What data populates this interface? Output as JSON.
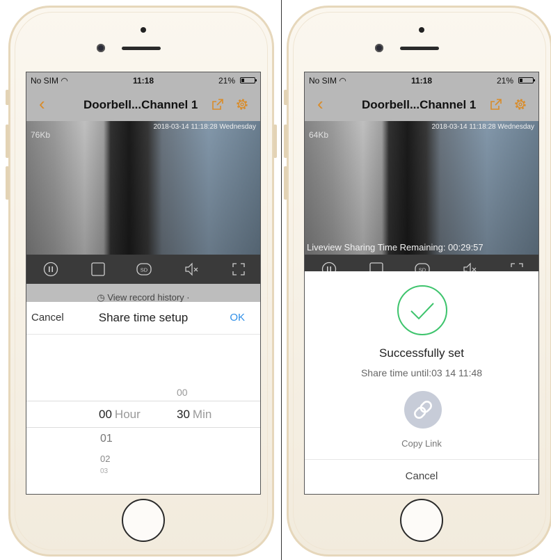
{
  "status_bar": {
    "carrier": "No SIM",
    "time": "11:18",
    "battery": "21%",
    "battery_level": 0.21
  },
  "left_screen": {
    "nav_title": "Doorbell...Channel 1",
    "video": {
      "osd_timestamp": "2018-03-14 11:18:28 Wednesday",
      "bitrate": "76Kb"
    },
    "controls": [
      "pause",
      "record",
      "SD",
      "mute",
      "fullscreen"
    ],
    "history_text": "View record history",
    "share_sheet": {
      "cancel": "Cancel",
      "title": "Share time setup",
      "ok": "OK",
      "hour_above": "",
      "hour_selected": "00",
      "hour_unit": "Hour",
      "hour_below": [
        "01",
        "02",
        "03"
      ],
      "min_above": "00",
      "min_selected": "30",
      "min_unit": "Min"
    }
  },
  "right_screen": {
    "nav_title": "Doorbell...Channel 1",
    "video": {
      "osd_timestamp": "2018-03-14 11:18:28 Wednesday",
      "bitrate": "64Kb",
      "share_banner": "Liveview Sharing Time Remaining: 00:29:57"
    },
    "dialog": {
      "title": "Successfully set",
      "subtitle": "Share time until:03 14 11:48",
      "copy_link": "Copy Link",
      "cancel": "Cancel"
    }
  },
  "colors": {
    "accent_orange": "#d98c2a",
    "ok_blue": "#2f8fe8",
    "success_green": "#3ec46d"
  }
}
